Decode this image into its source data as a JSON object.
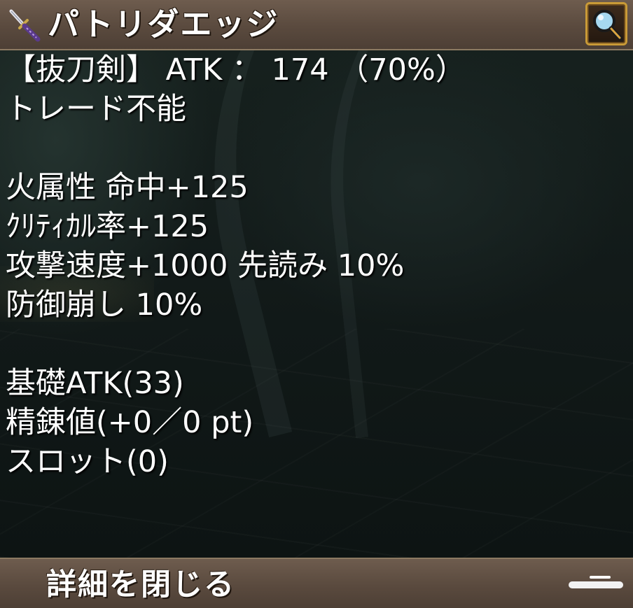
{
  "header": {
    "title": "パトリダエッジ",
    "icon": "katana-icon",
    "search_icon": "magnifier-icon"
  },
  "item": {
    "lines": [
      "【抜刀剣】 ATK ： 174 （70%）",
      "トレード不能",
      "",
      "火属性 命中+125",
      "ｸﾘﾃｨｶﾙ率+125",
      "攻撃速度+1000 先読み 10%",
      "防御崩し 10%",
      "",
      "基礎ATK(33)",
      "精錬値(+0／0 pt)",
      "スロット(0)"
    ]
  },
  "footer": {
    "close_label": "詳細を閉じる"
  },
  "colors": {
    "bar": "#5a4a3e",
    "search_border": "#c99a37",
    "text": "#ffffff"
  }
}
